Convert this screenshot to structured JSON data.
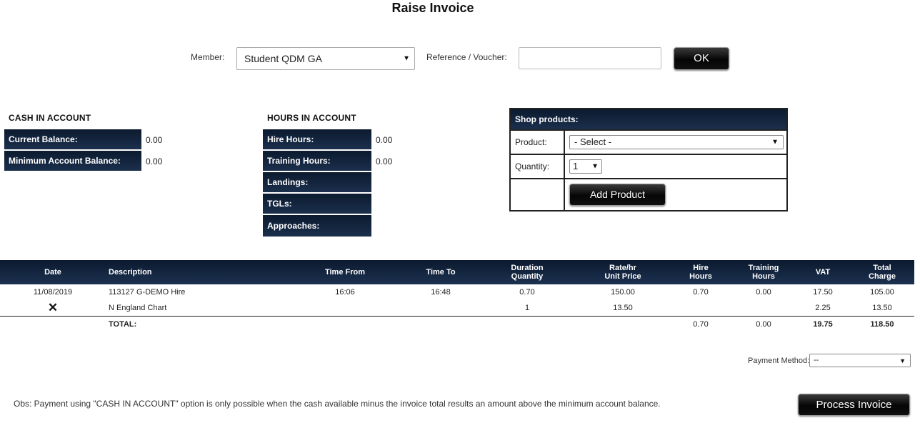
{
  "page": {
    "title": "Raise Invoice"
  },
  "form": {
    "member_label": "Member:",
    "member_value": "Student QDM GA",
    "reference_label": "Reference / Voucher:",
    "reference_value": "",
    "ok_label": "OK"
  },
  "cash": {
    "title": "CASH IN ACCOUNT",
    "rows": [
      {
        "label": "Current Balance:",
        "value": "0.00"
      },
      {
        "label": "Minimum Account Balance:",
        "value": "0.00"
      }
    ]
  },
  "hours": {
    "title": "HOURS IN ACCOUNT",
    "rows": [
      {
        "label": "Hire Hours:",
        "value": "0.00"
      },
      {
        "label": "Training Hours:",
        "value": "0.00"
      },
      {
        "label": "Landings:",
        "value": ""
      },
      {
        "label": "TGLs:",
        "value": ""
      },
      {
        "label": "Approaches:",
        "value": ""
      }
    ]
  },
  "shop": {
    "title": "Shop products:",
    "product_label": "Product:",
    "product_value": "- Select -",
    "quantity_label": "Quantity:",
    "quantity_value": "1",
    "add_label": "Add Product"
  },
  "table": {
    "headers": {
      "date": "Date",
      "description": "Description",
      "time_from": "Time From",
      "time_to": "Time To",
      "duration_1": "Duration",
      "duration_2": "Quantity",
      "rate_1": "Rate/hr",
      "rate_2": "Unit Price",
      "hire_1": "Hire",
      "hire_2": "Hours",
      "training_1": "Training",
      "training_2": "Hours",
      "vat": "VAT",
      "total_1": "Total",
      "total_2": "Charge"
    },
    "rows": [
      {
        "date": "11/08/2019",
        "description": "113127 G-DEMO Hire",
        "time_from": "16:06",
        "time_to": "16:48",
        "duration": "0.70",
        "rate": "150.00",
        "hire": "0.70",
        "training": "0.00",
        "vat": "17.50",
        "total": "105.00"
      },
      {
        "date": "",
        "delete_icon": "✕",
        "description": "N England Chart",
        "time_from": "",
        "time_to": "",
        "duration": "1",
        "rate": "13.50",
        "hire": "",
        "training": "",
        "vat": "2.25",
        "total": "13.50"
      }
    ],
    "totals": {
      "label": "TOTAL:",
      "hire": "0.70",
      "training": "0.00",
      "vat": "19.75",
      "total": "118.50"
    }
  },
  "payment": {
    "label": "Payment Method:",
    "value": "--"
  },
  "footer": {
    "obs": "Obs: Payment using \"CASH IN ACCOUNT\" option is only possible when the cash available minus the invoice total results an amount above the minimum account balance.",
    "process_label": "Process Invoice"
  },
  "colors": {
    "navy_top": "#0b1a2e",
    "navy_bottom": "#1c3150",
    "button_dark": "#050505"
  }
}
